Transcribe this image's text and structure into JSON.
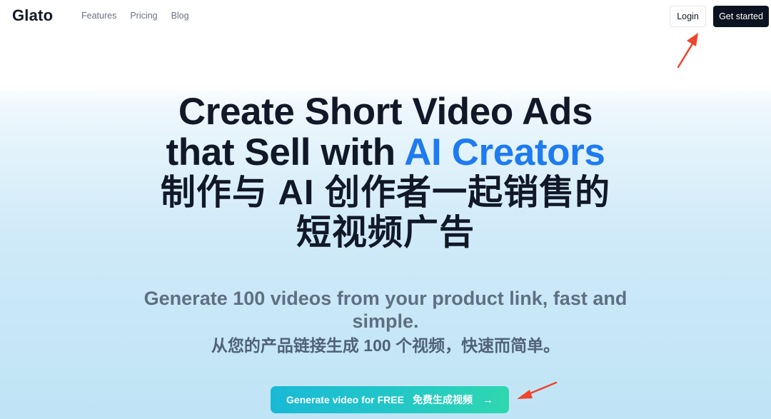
{
  "nav": {
    "logo": "Glato",
    "links": [
      "Features",
      "Pricing",
      "Blog"
    ],
    "login_label": "Login",
    "get_started_label": "Get started"
  },
  "hero": {
    "title_line1": "Create Short Video Ads",
    "title_line2_plain": "that Sell with ",
    "title_line2_accent": "AI Creators",
    "title_cn_line1": "制作与 AI 创作者一起销售的",
    "title_cn_line2": "短视频广告",
    "subtitle_en_line1": "Generate 100 videos from your product link, fast and",
    "subtitle_en_line2": "simple.",
    "subtitle_cn": "从您的产品链接生成 100 个视频，快速而简单。",
    "cta_label": "Generate video for FREE",
    "cta_cn": "免费生成视频",
    "cta_icon": "arrow-right-icon"
  },
  "colors": {
    "accent": "#1e7bf0",
    "annotation": "#f0442c",
    "cta_start": "#1ab9d6",
    "cta_end": "#2fd7b0"
  }
}
